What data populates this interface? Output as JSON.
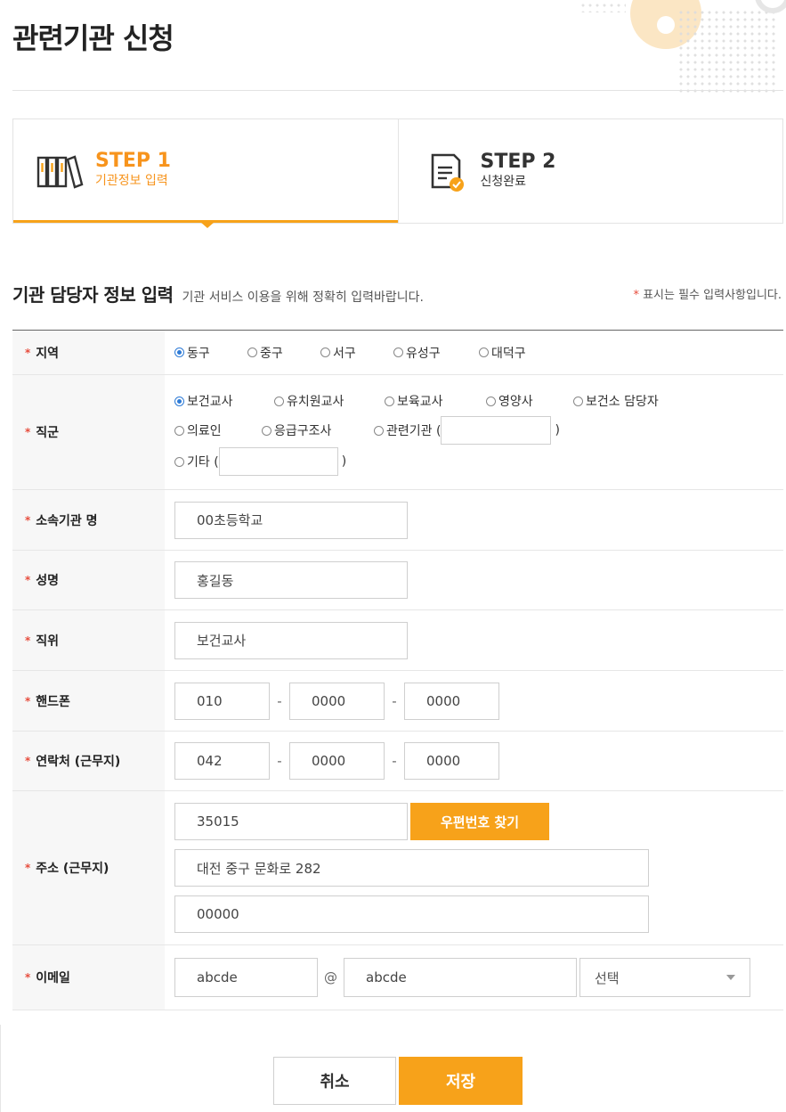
{
  "page": {
    "title": "관련기관 신청"
  },
  "steps": [
    {
      "number": "STEP 1",
      "desc": "기관정보 입력",
      "icon": "bookshelf-icon",
      "active": true
    },
    {
      "number": "STEP 2",
      "desc": "신청완료",
      "icon": "document-check-icon",
      "active": false
    }
  ],
  "section": {
    "title": "기관 담당자 정보 입력",
    "subtitle": "기관 서비스 이용을 위해 정확히 입력바랍니다.",
    "required_note_star": "*",
    "required_note": "표시는 필수 입력사항입니다."
  },
  "form": {
    "region": {
      "label": "지역",
      "options": [
        "동구",
        "중구",
        "서구",
        "유성구",
        "대덕구"
      ],
      "selected": "동구"
    },
    "job": {
      "label": "직군",
      "options_row1": [
        "보건교사",
        "유치원교사",
        "보육교사",
        "영양사",
        "보건소 담당자"
      ],
      "options_row2": [
        "의료인",
        "응급구조사",
        "관련기관 ("
      ],
      "options_row3": [
        "기타 ("
      ],
      "paren_close": ")",
      "selected": "보건교사"
    },
    "org_name": {
      "label": "소속기관 명",
      "value": "00초등학교"
    },
    "name": {
      "label": "성명",
      "value": "홍길동"
    },
    "position": {
      "label": "직위",
      "value": "보건교사"
    },
    "phone": {
      "label": "핸드폰",
      "p1": "010",
      "p2": "0000",
      "p3": "0000",
      "separator": "-"
    },
    "work_phone": {
      "label": "연락처 (근무지)",
      "p1": "042",
      "p2": "0000",
      "p3": "0000",
      "separator": "-"
    },
    "address": {
      "label": "주소 (근무지)",
      "zipcode": "35015",
      "zip_button": "우편번호 찾기",
      "address1": "대전 중구 문화로 282",
      "address2": "00000"
    },
    "email": {
      "label": "이메일",
      "local": "abcde",
      "at": "@",
      "domain": "abcde",
      "select": "선택"
    }
  },
  "buttons": {
    "cancel": "취소",
    "save": "저장"
  },
  "colors": {
    "accent": "#f7a21a",
    "required": "#e74c3c",
    "radio_on": "#2e7bd6"
  }
}
